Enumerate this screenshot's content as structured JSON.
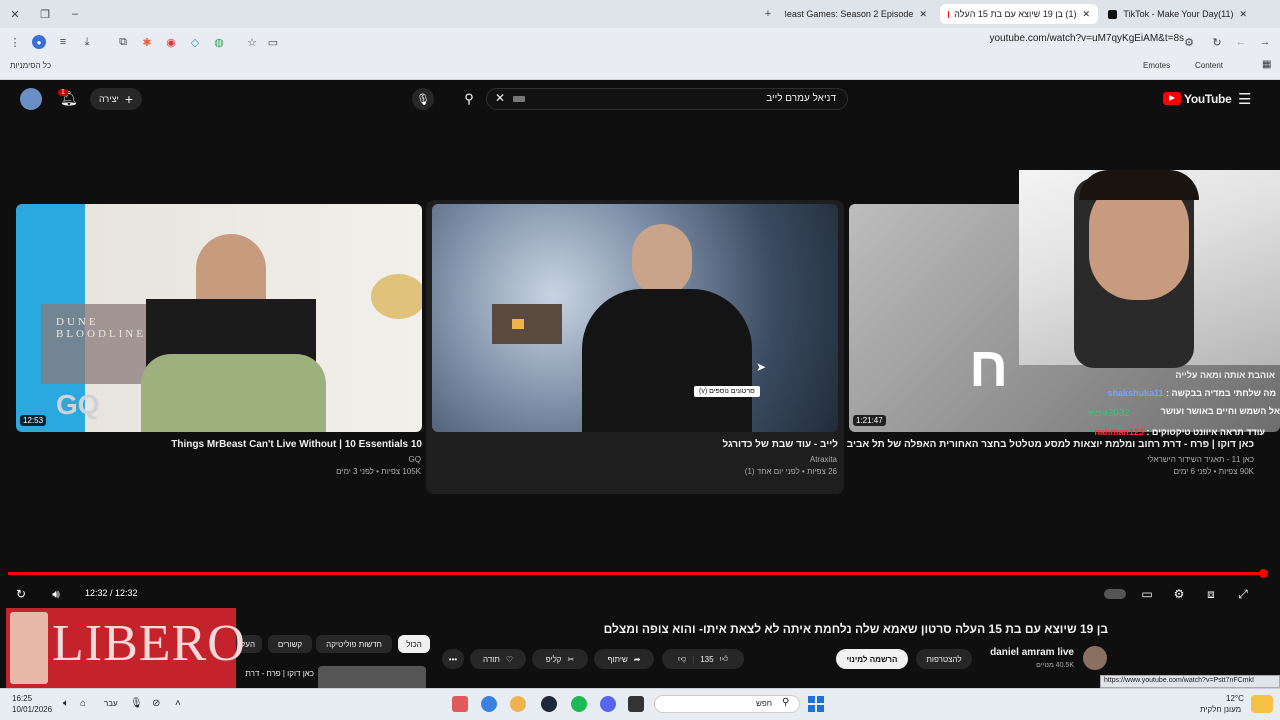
{
  "browser": {
    "tabs": [
      {
        "label": "Beast Games: Season 2 Episode",
        "active": false
      },
      {
        "label": "(1) בן 19 שיוצא עם בת 15 העלה",
        "active": true
      },
      {
        "label": "(11)TikTok - Make Your Day",
        "active": false
      }
    ],
    "url": "youtube.com/watch?v=uM7qyKgEiAM&t=8s",
    "bookmarks_left": "כל הסימניות",
    "bookmarks_right": [
      "Emotes",
      "Content"
    ]
  },
  "youtube": {
    "logo": "YouTube",
    "search_value": "דניאל עמרם לייב",
    "create_label": "יצירה",
    "notification_count": "1"
  },
  "cards": [
    {
      "title": "Things MrBeast Can't Live Without | 10 Essentials 10",
      "channel": "GQ",
      "meta": "105K צפיות • לפני 3 ימים",
      "duration": "12:53",
      "thumb_text": "DUNE BLOODLINES"
    },
    {
      "title": "לייב - עוד שבת של כדורגל",
      "channel": "Atraxita",
      "meta": "26 צפיות • לפני יום אחד (1)",
      "duration": "",
      "tooltip": "סרטונים נוספים (v)"
    },
    {
      "title": "כאן דוקו | פרח - דרת רחוב ומלמת יוצאות למסע מטלטל בחצר האחורית האפלה של תל אביב",
      "channel": "כאן 11 - תאגיד השידור הישראלי",
      "meta": "90K צפיות • לפני 6 ימים",
      "duration": "1:21:47"
    }
  ],
  "chat": {
    "header": "אוהבת אותה ומאה עלייה",
    "lines": [
      {
        "user": "shakshuka11",
        "text": "מה שלחתי במדיה בבקשה"
      },
      {
        "user": "",
        "text": "אל השמש וחיים באושר ועושר"
      },
      {
        "user": "ezra2032",
        "text": ""
      },
      {
        "user": "nahman123",
        "text": "עודד תראה איוונט טיקטוקים"
      }
    ]
  },
  "player": {
    "time": "12:32 / 12:32",
    "progress_fraction": 1.0
  },
  "video": {
    "title": "בן 19 שיוצא עם בת 15 העלה סרטון שאמא שלה נלחמת איתה לא לצאת איתו- והוא צופה ומצלם",
    "channel": "daniel amram live",
    "subscribers": "40.5K מנויים",
    "join_label": "להצטרפות",
    "subscribe_label": "הרשמה למינוי",
    "likes": "135",
    "share_label": "שיתוף",
    "clip_label": "קליפ",
    "thanks_label": "תודה"
  },
  "filters": [
    "הכול",
    "חדשות פוליטיקה",
    "קשורים",
    "העלו"
  ],
  "related_title": "כאן דוקו | פרח - דרת",
  "ad_text": "LIBERO",
  "status_url": "https://www.youtube.com/watch?v=Pstt7nFCmkI",
  "taskbar": {
    "time": "16:25",
    "date": "10/01/2026",
    "lang": "עבר",
    "search": "חפש",
    "weather_temp": "12°C",
    "weather_desc": "מעונן חלקית"
  },
  "colors": {
    "yt_red": "#ff0000",
    "accent_green": "#2ecc71"
  }
}
